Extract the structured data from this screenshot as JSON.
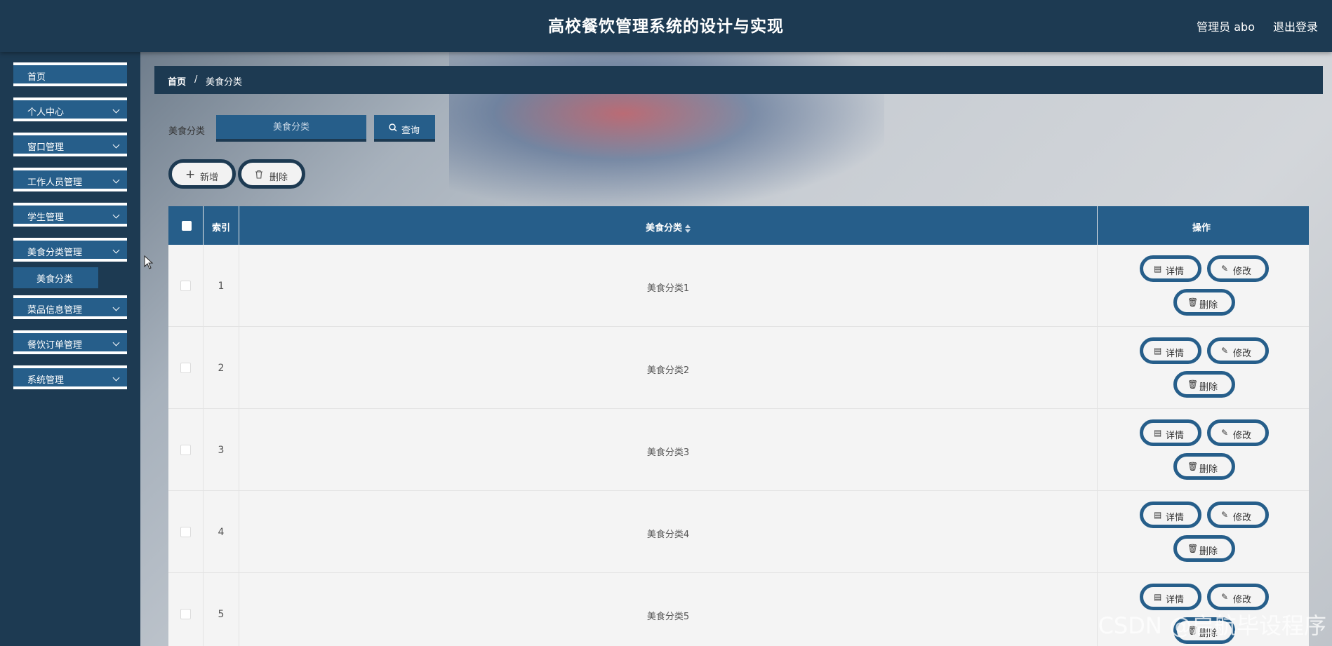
{
  "header": {
    "title": "高校餐饮管理系统的设计与实现",
    "user": "管理员 abo",
    "logout": "退出登录"
  },
  "sidebar": {
    "items": [
      {
        "label": "首页",
        "expandable": false
      },
      {
        "label": "个人中心",
        "expandable": true
      },
      {
        "label": "窗口管理",
        "expandable": true
      },
      {
        "label": "工作人员管理",
        "expandable": true
      },
      {
        "label": "学生管理",
        "expandable": true
      },
      {
        "label": "美食分类管理",
        "expandable": true,
        "expanded": true
      },
      {
        "label": "菜品信息管理",
        "expandable": true
      },
      {
        "label": "餐饮订单管理",
        "expandable": true
      },
      {
        "label": "系统管理",
        "expandable": true
      }
    ],
    "submenu": {
      "label": "美食分类"
    }
  },
  "breadcrumb": {
    "home": "首页",
    "separator": "/",
    "current": "美食分类"
  },
  "search": {
    "label": "美食分类",
    "placeholder": "美食分类",
    "button": "查询"
  },
  "actions": {
    "add": "新增",
    "delete": "删除"
  },
  "table": {
    "columns": {
      "index": "索引",
      "name": "美食分类",
      "action": "操作"
    },
    "rows": [
      {
        "index": "1",
        "name": "美食分类1"
      },
      {
        "index": "2",
        "name": "美食分类2"
      },
      {
        "index": "3",
        "name": "美食分类3"
      },
      {
        "index": "4",
        "name": "美食分类4"
      },
      {
        "index": "5",
        "name": "美食分类5"
      }
    ],
    "row_actions": {
      "detail": "详情",
      "edit": "修改",
      "delete": "删除"
    }
  },
  "watermark": "CSDN @启航毕设程序",
  "colors": {
    "primary": "#265e8a",
    "dark": "#1d3a52"
  }
}
